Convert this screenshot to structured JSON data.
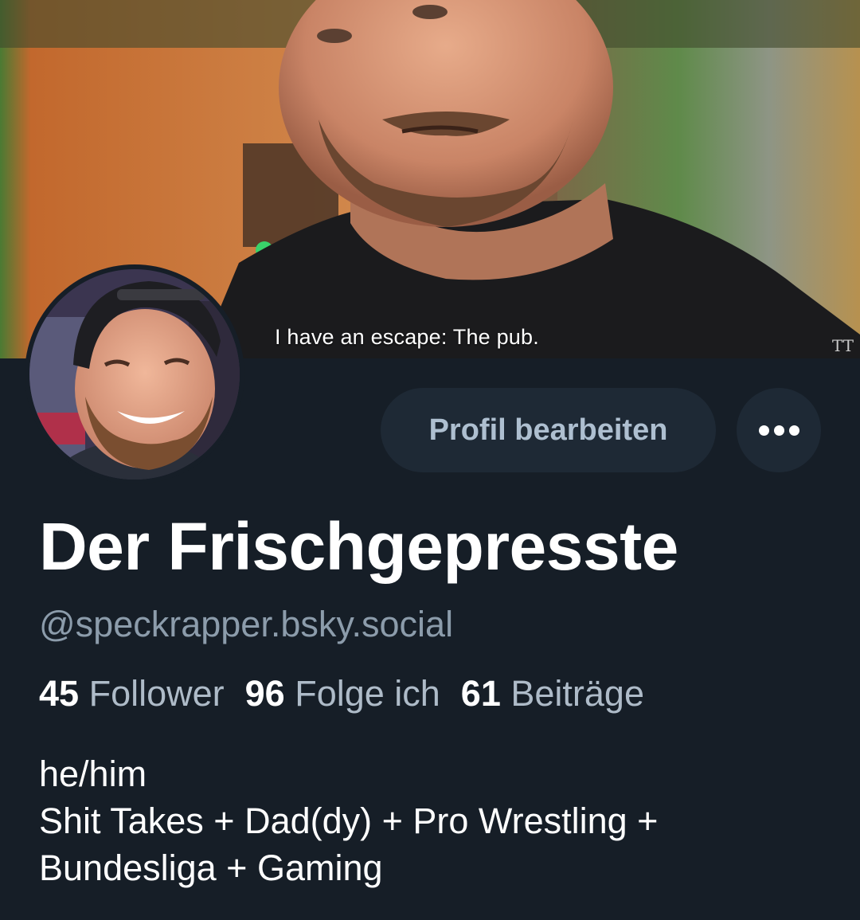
{
  "banner": {
    "caption": "I have an escape: The pub.",
    "watermark": "TT"
  },
  "profile": {
    "display_name": "Der Frischgepresste",
    "handle": "@speckrapper.bsky.social"
  },
  "actions": {
    "edit_label": "Profil bearbeiten",
    "more_icon": "ellipsis-icon"
  },
  "stats": [
    {
      "count": "45",
      "label": "Follower"
    },
    {
      "count": "96",
      "label": "Folge ich"
    },
    {
      "count": "61",
      "label": "Beiträge"
    }
  ],
  "bio": {
    "lines": [
      "he/him",
      "Shit Takes + Dad(dy) + Pro Wrestling +",
      "Bundesliga + Gaming"
    ]
  },
  "colors": {
    "background": "#161e27",
    "button_bg": "#1e2935",
    "button_text": "#aebfd0",
    "handle_text": "#8c9cab"
  }
}
